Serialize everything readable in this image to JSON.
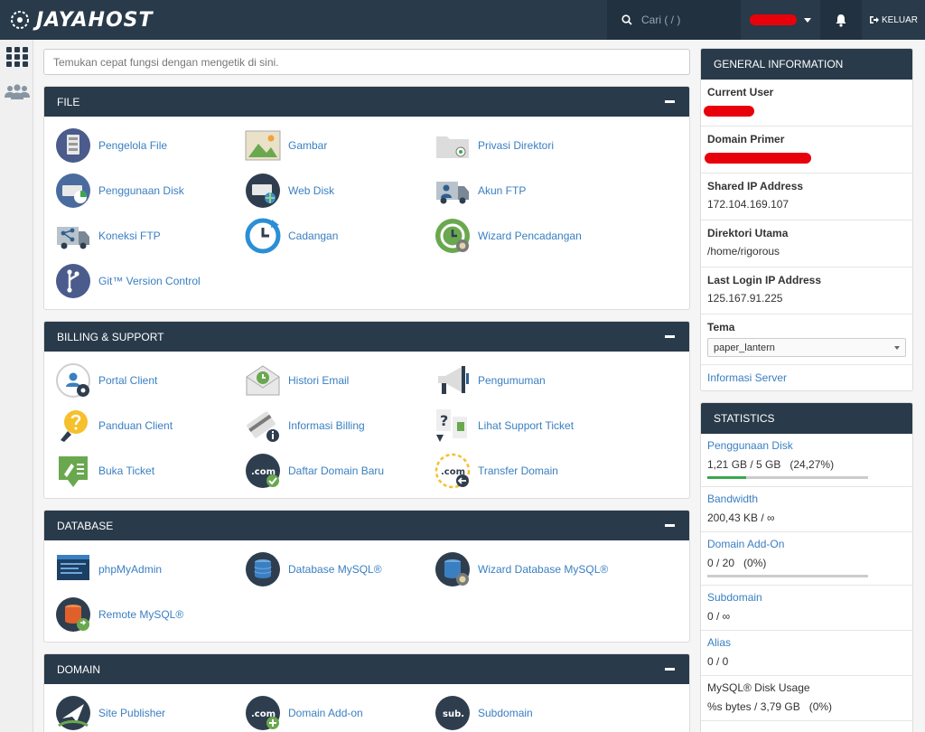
{
  "header": {
    "brand": "JAYAHOST",
    "search_placeholder": "Cari ( / )",
    "logout_label": "KELUAR"
  },
  "quick_search": {
    "placeholder": "Temukan cepat fungsi dengan mengetik di sini."
  },
  "panels": [
    {
      "title": "FILE",
      "items": [
        {
          "label": "Pengelola File",
          "icon": "file-manager-icon"
        },
        {
          "label": "Gambar",
          "icon": "images-icon"
        },
        {
          "label": "Privasi Direktori",
          "icon": "directory-privacy-icon"
        },
        {
          "label": "Penggunaan Disk",
          "icon": "disk-usage-icon"
        },
        {
          "label": "Web Disk",
          "icon": "web-disk-icon"
        },
        {
          "label": "Akun FTP",
          "icon": "ftp-accounts-icon"
        },
        {
          "label": "Koneksi FTP",
          "icon": "ftp-connections-icon"
        },
        {
          "label": "Cadangan",
          "icon": "backup-icon"
        },
        {
          "label": "Wizard Pencadangan",
          "icon": "backup-wizard-icon"
        },
        {
          "label": "Git™ Version Control",
          "icon": "git-icon"
        }
      ]
    },
    {
      "title": "BILLING & SUPPORT",
      "items": [
        {
          "label": "Portal Client",
          "icon": "client-portal-icon"
        },
        {
          "label": "Histori Email",
          "icon": "email-history-icon"
        },
        {
          "label": "Pengumuman",
          "icon": "megaphone-icon"
        },
        {
          "label": "Panduan Client",
          "icon": "help-lightbulb-icon"
        },
        {
          "label": "Informasi Billing",
          "icon": "billing-info-icon"
        },
        {
          "label": "Lihat Support Ticket",
          "icon": "view-ticket-icon"
        },
        {
          "label": "Buka Ticket",
          "icon": "open-ticket-icon"
        },
        {
          "label": "Daftar Domain Baru",
          "icon": "register-domain-icon"
        },
        {
          "label": "Transfer Domain",
          "icon": "transfer-domain-icon"
        }
      ]
    },
    {
      "title": "DATABASE",
      "items": [
        {
          "label": "phpMyAdmin",
          "icon": "phpmyadmin-icon"
        },
        {
          "label": "Database MySQL®",
          "icon": "mysql-database-icon"
        },
        {
          "label": "Wizard Database MySQL®",
          "icon": "mysql-wizard-icon"
        },
        {
          "label": "Remote MySQL®",
          "icon": "remote-mysql-icon"
        }
      ]
    },
    {
      "title": "DOMAIN",
      "items": [
        {
          "label": "Site Publisher",
          "icon": "site-publisher-icon"
        },
        {
          "label": "Domain Add-on",
          "icon": "addon-domain-icon"
        },
        {
          "label": "Subdomain",
          "icon": "subdomain-icon"
        }
      ]
    }
  ],
  "general_info": {
    "title": "GENERAL INFORMATION",
    "current_user_label": "Current User",
    "primary_domain_label": "Domain Primer",
    "shared_ip_label": "Shared IP Address",
    "shared_ip_value": "172.104.169.107",
    "home_dir_label": "Direktori Utama",
    "home_dir_value": "/home/rigorous",
    "last_login_label": "Last Login IP Address",
    "last_login_value": "125.167.91.225",
    "theme_label": "Tema",
    "theme_value": "paper_lantern",
    "server_info_link": "Informasi Server"
  },
  "statistics": {
    "title": "STATISTICS",
    "rows": [
      {
        "label": "Penggunaan Disk",
        "value": "1,21 GB / 5 GB   (24,27%)",
        "percent": 24.27,
        "has_bar": true
      },
      {
        "label": "Bandwidth",
        "value": "200,43 KB / ∞",
        "has_bar": false
      },
      {
        "label": "Domain Add-On",
        "value": "0 / 20   (0%)",
        "percent": 0,
        "has_bar": true
      },
      {
        "label": "Subdomain",
        "value": "0 / ∞",
        "has_bar": false
      },
      {
        "label": "Alias",
        "value": "0 / 0",
        "has_bar": false
      },
      {
        "label": "MySQL® Disk Usage",
        "value": "%s bytes / 3,79 GB   (0%)",
        "has_bar": false
      }
    ]
  },
  "colors": {
    "header_bg": "#293a4a",
    "link": "#3a7fc1",
    "progress": "#3aa84c",
    "redaction": "#e8000b"
  }
}
